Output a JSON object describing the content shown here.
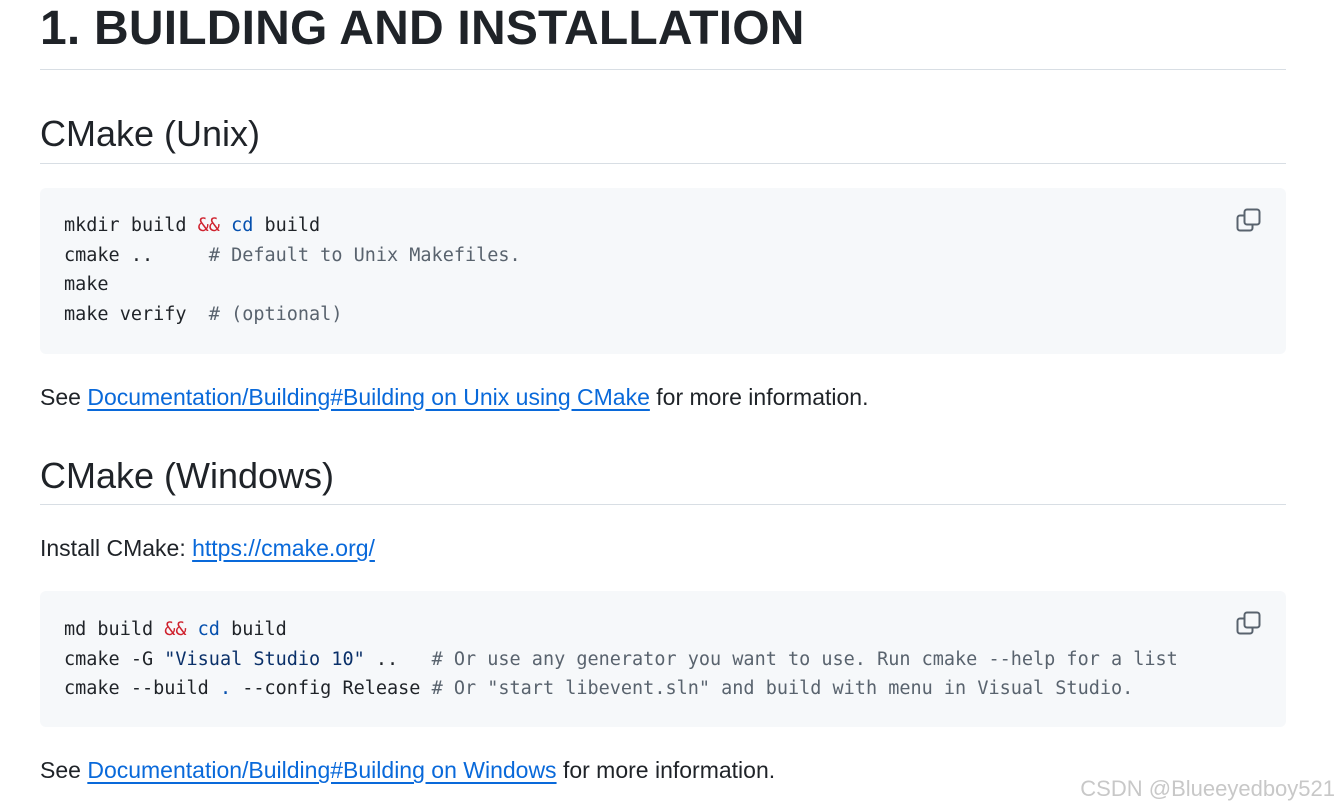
{
  "headings": {
    "h1": "1. BUILDING AND INSTALLATION",
    "unix": "CMake (Unix)",
    "windows": "CMake (Windows)"
  },
  "unix_code": {
    "l1_a": "mkdir build ",
    "l1_amp": "&&",
    "l1_sp": " ",
    "l1_cd": "cd",
    "l1_b": " build",
    "l2_a": "cmake ..     ",
    "l2_c": "# Default to Unix Makefiles.",
    "l3": "make",
    "l4_a": "make verify  ",
    "l4_c": "# (optional)"
  },
  "unix_para": {
    "pre": "See ",
    "link": "Documentation/Building#Building on Unix using CMake",
    "post": " for more information."
  },
  "install": {
    "pre": "Install CMake: ",
    "link": "https://cmake.org/"
  },
  "win_code": {
    "l1_a": "md build ",
    "l1_amp": "&&",
    "l1_sp": " ",
    "l1_cd": "cd",
    "l1_b": " build",
    "l2_a": "cmake -G ",
    "l2_str": "\"Visual Studio 10\"",
    "l2_b": " ..   ",
    "l2_c": "# Or use any generator you want to use. Run cmake --help for a list",
    "l3_a": "cmake --build ",
    "l3_dot": ".",
    "l3_b": " --config Release ",
    "l3_c": "# Or \"start libevent.sln\" and build with menu in Visual Studio."
  },
  "win_para": {
    "pre": "See ",
    "link": "Documentation/Building#Building on Windows",
    "post": " for more information."
  },
  "watermark": "CSDN @Blueeyedboy521",
  "icons": {
    "copy": "copy-icon"
  },
  "colors": {
    "link": "#0969da",
    "code_bg": "#f6f8fa",
    "operator": "#cf222e",
    "builtin": "#0550ae",
    "comment": "#59636e"
  }
}
